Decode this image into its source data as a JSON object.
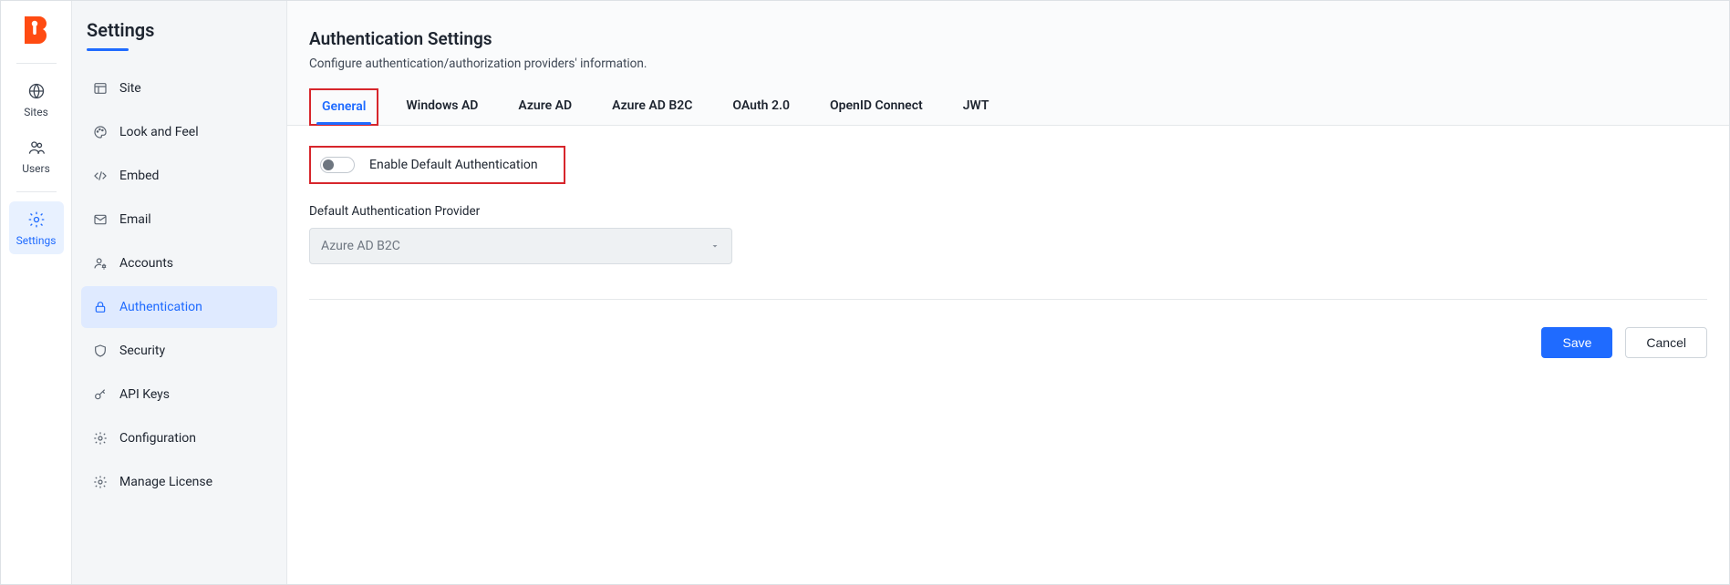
{
  "rail": {
    "items": [
      {
        "id": "sites",
        "label": "Sites"
      },
      {
        "id": "users",
        "label": "Users"
      },
      {
        "id": "settings",
        "label": "Settings"
      }
    ],
    "active": "settings"
  },
  "sidebar": {
    "title": "Settings",
    "items": [
      {
        "id": "site",
        "label": "Site"
      },
      {
        "id": "look-and-feel",
        "label": "Look and Feel"
      },
      {
        "id": "embed",
        "label": "Embed"
      },
      {
        "id": "email",
        "label": "Email"
      },
      {
        "id": "accounts",
        "label": "Accounts"
      },
      {
        "id": "authentication",
        "label": "Authentication"
      },
      {
        "id": "security",
        "label": "Security"
      },
      {
        "id": "api-keys",
        "label": "API Keys"
      },
      {
        "id": "configuration",
        "label": "Configuration"
      },
      {
        "id": "manage-license",
        "label": "Manage License"
      }
    ],
    "active": "authentication"
  },
  "page": {
    "title": "Authentication Settings",
    "subtitle": "Configure authentication/authorization providers' information."
  },
  "tabs": [
    {
      "id": "general",
      "label": "General"
    },
    {
      "id": "windows-ad",
      "label": "Windows AD"
    },
    {
      "id": "azure-ad",
      "label": "Azure AD"
    },
    {
      "id": "azure-ad-b2c",
      "label": "Azure AD B2C"
    },
    {
      "id": "oauth20",
      "label": "OAuth 2.0"
    },
    {
      "id": "openid-connect",
      "label": "OpenID Connect"
    },
    {
      "id": "jwt",
      "label": "JWT"
    }
  ],
  "tabs_active": "general",
  "general": {
    "enable_toggle_label": "Enable Default Authentication",
    "enable_toggle_on": false,
    "provider_field_label": "Default Authentication Provider",
    "provider_selected": "Azure AD B2C"
  },
  "actions": {
    "save": "Save",
    "cancel": "Cancel"
  },
  "colors": {
    "accent": "#1f6bff",
    "highlight_border": "#d7262c"
  }
}
